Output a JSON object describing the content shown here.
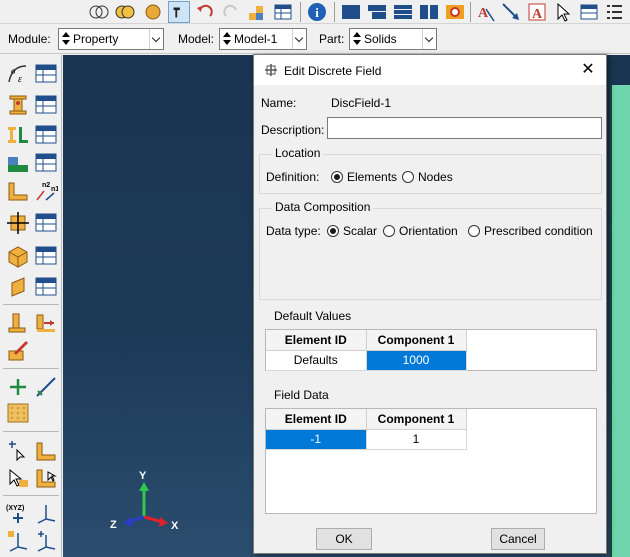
{
  "module_bar": {
    "module_label": "Module:",
    "module_value": "Property",
    "model_label": "Model:",
    "model_value": "Model-1",
    "part_label": "Part:",
    "part_value": "Solids"
  },
  "triad": {
    "x": "X",
    "y": "Y",
    "z": "Z"
  },
  "dialog": {
    "title": "Edit Discrete Field",
    "name_label": "Name:",
    "name_value": "DiscField-1",
    "description_label": "Description:",
    "description_value": "",
    "location": {
      "title": "Location",
      "definition_label": "Definition:",
      "options": [
        "Elements",
        "Nodes"
      ],
      "selected": "Elements"
    },
    "data_composition": {
      "title": "Data Composition",
      "data_type_label": "Data type:",
      "options": [
        "Scalar",
        "Orientation",
        "Prescribed condition"
      ],
      "selected": "Scalar"
    },
    "default_values": {
      "title": "Default Values",
      "headers": [
        "Element ID",
        "Component 1"
      ],
      "rows": [
        [
          "Defaults",
          "1000"
        ]
      ]
    },
    "field_data": {
      "title": "Field Data",
      "headers": [
        "Element ID",
        "Component 1"
      ],
      "rows": [
        [
          "-1",
          "1"
        ]
      ]
    },
    "ok_label": "OK",
    "cancel_label": "Cancel"
  },
  "colors": {
    "viewport_bg": "#1c3a58",
    "selection": "#0078d7",
    "part_color": "#6fd6ad"
  }
}
